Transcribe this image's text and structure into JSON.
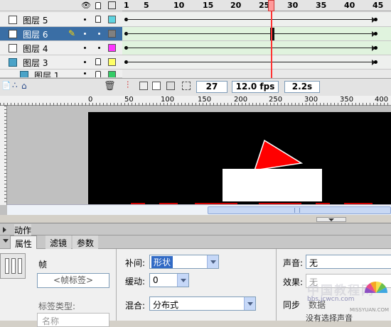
{
  "timeline": {
    "ruler_numbers": [
      "1",
      "5",
      "10",
      "15",
      "20",
      "25",
      "30",
      "35",
      "40",
      "45"
    ],
    "layers": [
      {
        "name": "图层 5",
        "color": "#5fd3e0",
        "selected": false
      },
      {
        "name": "图层 6",
        "color": "#808080",
        "selected": true
      },
      {
        "name": "图层 4",
        "color": "#ff33ff",
        "selected": false
      },
      {
        "name": "图层 3",
        "color": "#ffff66",
        "selected": false
      },
      {
        "name": "图层 1",
        "color": "#33cc66",
        "selected": false
      }
    ],
    "current_frame": "27",
    "fps": "12.0 fps",
    "elapsed": "2.2s"
  },
  "stage": {
    "ruler_numbers": [
      "0",
      "50",
      "100",
      "150",
      "200",
      "250",
      "300",
      "350",
      "400"
    ]
  },
  "panels": {
    "actions_title": "动作",
    "tabs": [
      "属性",
      "滤镜",
      "参数"
    ]
  },
  "properties": {
    "frame_label": "帧",
    "frame_label_placeholder": "<帧标签>",
    "label_type_label": "标签类型:",
    "label_type_value": "名称",
    "tween_label": "补间:",
    "tween_value": "形状",
    "ease_label": "缓动:",
    "ease_value": "0",
    "blend_label": "混合:",
    "blend_value": "分布式",
    "sound_label": "声音:",
    "sound_value": "无",
    "effect_label": "效果:",
    "effect_value": "无",
    "sync_label": "同步",
    "sync_value": "数据",
    "no_sound_text": "没有选择声音"
  },
  "watermark": {
    "text1": "中国教程网",
    "text2": "bbs.jcwcn.com",
    "text3": "MISSYUAN.COM"
  },
  "colors": {
    "selection": "#3a6ea5",
    "playhead": "#ff3333",
    "stage_bg": "#000000",
    "red_shape": "#ff0000"
  }
}
